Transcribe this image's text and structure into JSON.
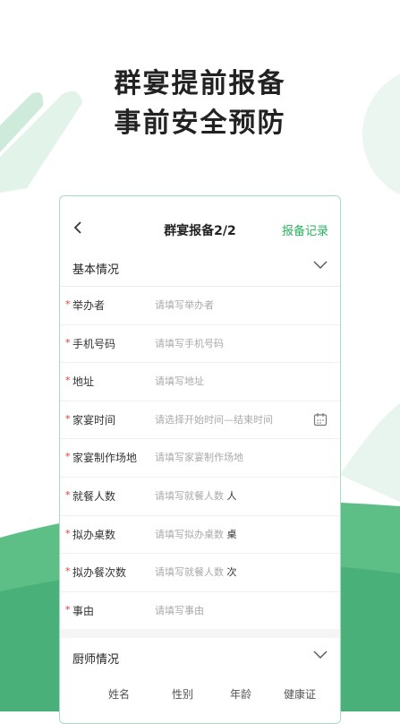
{
  "hero": {
    "line1": "群宴提前报备",
    "line2": "事前安全预防"
  },
  "nav": {
    "title": "群宴报备2/2",
    "record": "报备记录"
  },
  "basic": {
    "heading": "基本情况",
    "rows": [
      {
        "label": "举办者",
        "placeholder": "请填写举办者",
        "unit": ""
      },
      {
        "label": "手机号码",
        "placeholder": "请填写手机号码",
        "unit": ""
      },
      {
        "label": "地址",
        "placeholder": "请填写地址",
        "unit": ""
      },
      {
        "label": "家宴时间",
        "placeholder": "请选择开始时间—结束时间",
        "unit": ""
      },
      {
        "label": "家宴制作场地",
        "placeholder": "请填写家宴制作场地",
        "unit": ""
      },
      {
        "label": "就餐人数",
        "placeholder": "请填写就餐人数",
        "unit": "人"
      },
      {
        "label": "拟办桌数",
        "placeholder": "请填写拟办桌数",
        "unit": "桌"
      },
      {
        "label": "拟办餐次数",
        "placeholder": "请填写就餐人数",
        "unit": "次"
      },
      {
        "label": "事由",
        "placeholder": "请填写事由",
        "unit": ""
      }
    ]
  },
  "chef": {
    "heading": "厨师情况",
    "columns": [
      "姓名",
      "性别",
      "年龄",
      "健康证"
    ]
  },
  "required_mark": "*",
  "colors": {
    "accent": "#26b35a",
    "required": "#e53935",
    "wave": "#5dbf86"
  }
}
